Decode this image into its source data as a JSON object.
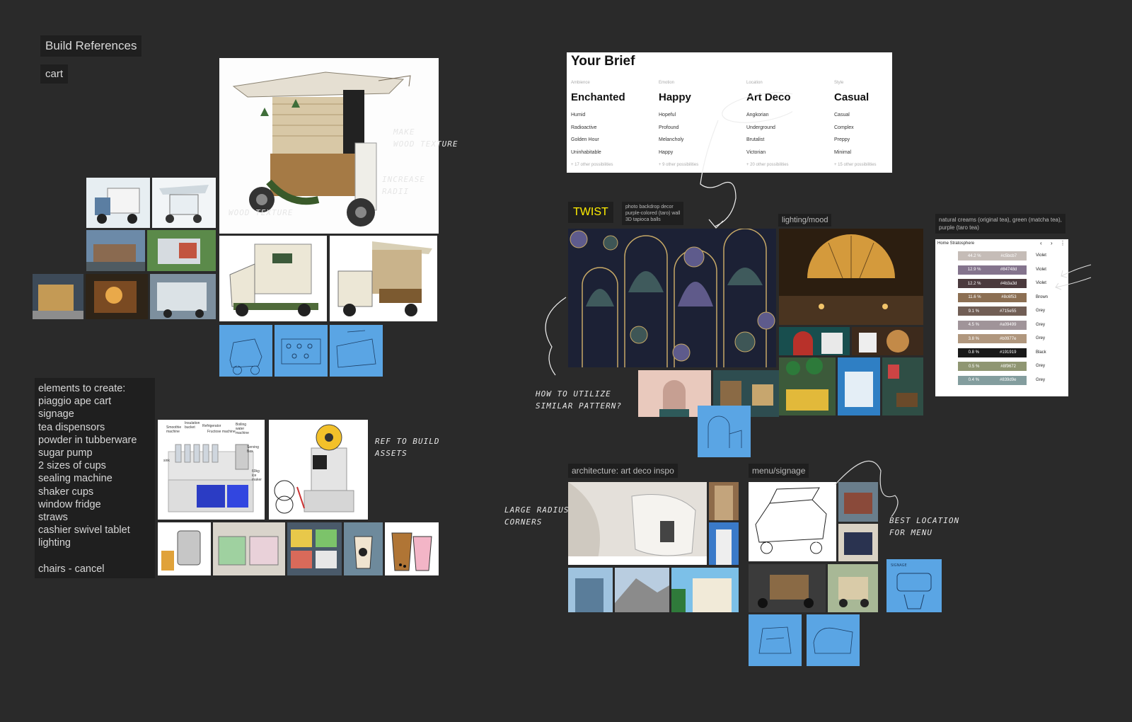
{
  "labels": {
    "build_references": "Build References",
    "cart": "cart",
    "twist": "TWIST",
    "twist_note": "photo backdrop decor\npurple-colored (taro) wall\n3D tapioca balls",
    "lighting": "lighting/mood",
    "palette_note": "natural creams (original tea), green (matcha tea),\npurple (taro tea)",
    "architecture": "architecture: art deco inspo",
    "menu": "menu/signage"
  },
  "handwritten": {
    "wood_texture_top": "MAKE\nWOOD TEXTURE",
    "increase_radii": "INCREASE\nRADII",
    "wood_texture": "WOOD TEXTURE",
    "ref_assets": "REF TO BUILD\nASSETS",
    "utilize_pattern": "HOW TO UTILIZE\nSIMILAR PATTERN?",
    "large_radius": "LARGE RADIUS\nCORNERS",
    "best_location": "BEST LOCATION\nFOR MENU"
  },
  "elements_list": {
    "heading": "elements to create:",
    "items": [
      "piaggio ape cart",
      "signage",
      "tea dispensors",
      "powder in tubberware",
      "sugar pump",
      "2 sizes of cups",
      "sealing machine",
      "shaker cups",
      "window fridge",
      "straws",
      "cashier swivel tablet",
      "lighting"
    ],
    "footer": "chairs - cancel"
  },
  "brief": {
    "title": "Your Brief",
    "columns": [
      {
        "ctl": "Ambience",
        "head": "Enchanted",
        "options": [
          "Humid",
          "Radioactive",
          "Golden Hour",
          "Uninhabitable"
        ],
        "more": "+ 17 other possibilities"
      },
      {
        "ctl": "Emotion",
        "head": "Happy",
        "options": [
          "Hopeful",
          "Profound",
          "Melancholy",
          "Happy"
        ],
        "more": "+ 9 other possibilities"
      },
      {
        "ctl": "Location",
        "head": "Art Deco",
        "options": [
          "Angkorian",
          "Underground",
          "Brutalist",
          "Victorian"
        ],
        "more": "+ 20 other possibilities"
      },
      {
        "ctl": "Style",
        "head": "Casual",
        "options": [
          "Casual",
          "Complex",
          "Preppy",
          "Minimal"
        ],
        "more": "+ 15 other possibilities"
      }
    ]
  },
  "palette": {
    "title": "Home Stratosphere",
    "rows": [
      {
        "pct": "44.2 %",
        "hex": "#c5bcb7",
        "name": "Violet"
      },
      {
        "pct": "12.9 %",
        "hex": "#84748d",
        "name": "Violet"
      },
      {
        "pct": "12.2 %",
        "hex": "#4b3a3d",
        "name": "Violet"
      },
      {
        "pct": "11.6 %",
        "hex": "#8c6f53",
        "name": "Brown"
      },
      {
        "pct": "9.1 %",
        "hex": "#715e55",
        "name": "Grey"
      },
      {
        "pct": "4.5 %",
        "hex": "#a09499",
        "name": "Grey"
      },
      {
        "pct": "3.8 %",
        "hex": "#b0977e",
        "name": "Grey"
      },
      {
        "pct": "0.8 %",
        "hex": "#191919",
        "name": "Black"
      },
      {
        "pct": "0.5 %",
        "hex": "#8f9672",
        "name": "Grey"
      },
      {
        "pct": "0.4 %",
        "hex": "#839d9e",
        "name": "Grey"
      }
    ]
  },
  "machine_labels": {
    "smoothie": "Smoothie machine",
    "insulation": "Insulation bucket",
    "refrigerator": "Refrigerator",
    "fructose": "Fructose machine",
    "boiling": "Boiling water machine",
    "serving": "Serving Box",
    "sink": "sink",
    "ice": "60kg ice maker"
  }
}
